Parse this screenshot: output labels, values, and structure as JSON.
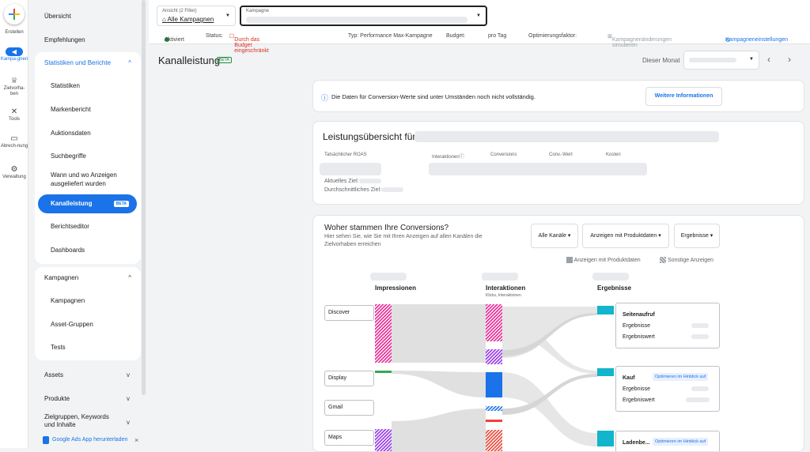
{
  "rail": {
    "create": "Erstellen",
    "items": [
      {
        "label": "Kampa-gnen",
        "icon": "megaphone-icon"
      },
      {
        "label": "Zielvorha-ben",
        "icon": "trophy-icon"
      },
      {
        "label": "Tools",
        "icon": "tools-icon"
      },
      {
        "label": "Abrech-nung",
        "icon": "billing-icon"
      },
      {
        "label": "Verwaltung",
        "icon": "gear-icon"
      }
    ]
  },
  "nav": {
    "uebersicht": "Übersicht",
    "empfehlungen": "Empfehlungen",
    "stats": "Statistiken und Berichte",
    "stats_items": [
      "Statistiken",
      "Markenbericht",
      "Auktionsdaten",
      "Suchbegriffe",
      "Wann und wo Anzeigen ausgeliefert wurden",
      "Kanalleistung",
      "Berichtseditor",
      "Dashboards"
    ],
    "beta": "BETA",
    "kampagnen": "Kampagnen",
    "kampagnen_items": [
      "Kampagnen",
      "Asset-Gruppen",
      "Tests"
    ],
    "assets": "Assets",
    "produkte": "Produkte",
    "zielgruppen": "Zielgruppen, Keywords und Inhalte",
    "download": "Google Ads App herunterladen"
  },
  "topbar": {
    "filter_label": "Ansicht (2 Filter)",
    "filter_value": "Alle Kampagnen",
    "campaign_label": "Kampagne"
  },
  "status": {
    "active": "Aktiviert",
    "status_label": "Status:",
    "limited": "Durch das Budget eingeschränkt",
    "type": "Typ: Performance Max-Kampagne",
    "budget": "Budget:",
    "budget_suffix": "pro Tag",
    "opt": "Optimierungsfaktor:",
    "simulate": "Kampagnenänderungen simulieren",
    "settings": "Kampagneneinstellungen"
  },
  "page": {
    "title": "Kanalleistung",
    "beta": "BETA",
    "period": "Dieser Monat"
  },
  "info": {
    "text": "Die Daten für Conversion-Werte sind unter Umständen noch nicht vollständig.",
    "button": "Weitere Informationen"
  },
  "overview": {
    "title": "Leistungsübersicht für",
    "cols": [
      "Tatsächlicher ROAS",
      "Interaktionen",
      "Conversions",
      "Conv.-Wert",
      "Kosten"
    ],
    "target": "Aktuelles Ziel:",
    "avg": "Durchschnittliches Ziel:"
  },
  "conv": {
    "title": "Woher stammen Ihre Conversions?",
    "desc": "Hier sehen Sie, wie Sie mit Ihren Anzeigen auf allen Kanälen die Zielvorhaben erreichen",
    "dd1": "Alle Kanäle",
    "dd2": "Anzeigen mit Produktdaten",
    "dd3": "Ergebnisse",
    "legend1": "Anzeigen mit Produktdaten",
    "legend2": "Sonstige Anzeigen",
    "col1": "Impressionen",
    "col2": "Interaktionen",
    "col2sub": "Klicks, Interaktionen",
    "col3": "Ergebnisse",
    "channels": [
      "Discover",
      "Display",
      "Gmail",
      "Maps"
    ],
    "r1": {
      "title": "Seitenaufruf",
      "l1": "Ergebnisse",
      "l2": "Ergebniswert"
    },
    "r2": {
      "title": "Kauf",
      "badge": "Optimieren im Hinblick auf",
      "l1": "Ergebnisse",
      "l2": "Ergebniswert"
    },
    "r3": {
      "title": "Ladenbe...",
      "badge": "Optimieren im Hinblick auf"
    }
  }
}
